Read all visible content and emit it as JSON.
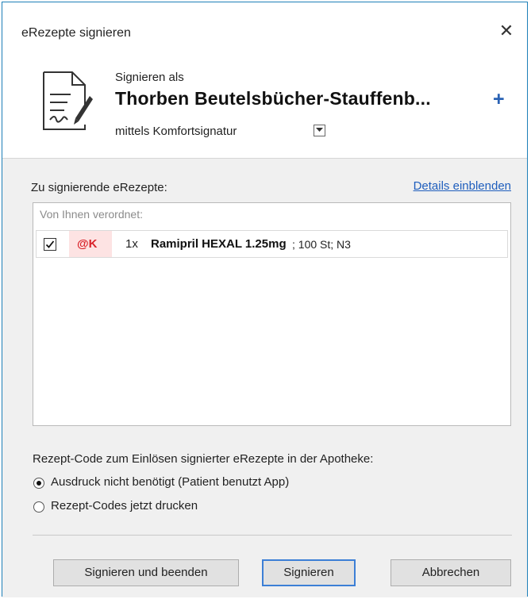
{
  "window": {
    "title": "eRezepte signieren"
  },
  "signer": {
    "label": "Signieren als",
    "name": "Thorben Beutelsbücher-Stauffenb...",
    "method": "mittels Komfortsignatur",
    "add_icon": "+"
  },
  "list": {
    "label": "Zu signierende eRezepte:",
    "details_link": "Details einblenden",
    "group_label": "Von Ihnen verordnet:",
    "items": [
      {
        "checked": true,
        "badge": "@K",
        "quantity": "1x",
        "name": "Ramipril HEXAL 1.25mg",
        "detail": "; 100 St; N3"
      }
    ]
  },
  "code": {
    "label": "Rezept-Code zum Einlösen signierter eRezepte in der Apotheke:",
    "options": [
      {
        "label": "Ausdruck nicht benötigt (Patient benutzt App)",
        "selected": true
      },
      {
        "label": "Rezept-Codes jetzt drucken",
        "selected": false
      }
    ]
  },
  "buttons": {
    "sign_and_close": "Signieren und beenden",
    "sign": "Signieren",
    "cancel": "Abbrechen"
  },
  "colors": {
    "accent": "#2a62b4",
    "window_border": "#1d7fb8",
    "badge_bg": "#fde3e3",
    "badge_text": "#d9232a",
    "link": "#1f5ebd"
  },
  "icons": {
    "document": "document-signature-icon",
    "close": "close-icon",
    "dropdown": "chevron-down-icon",
    "add": "plus-icon"
  }
}
